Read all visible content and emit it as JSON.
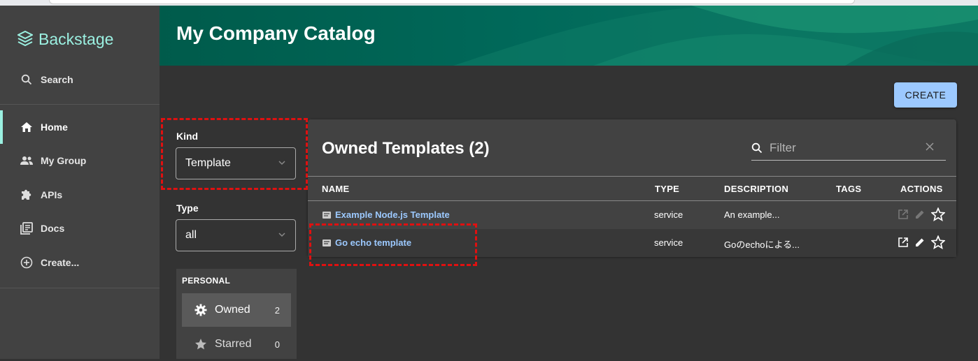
{
  "app": {
    "name": "Backstage",
    "page_title": "My Company Catalog"
  },
  "sidebar": {
    "search_label": "Search",
    "items": [
      {
        "label": "Home",
        "icon": "home-icon",
        "active": true
      },
      {
        "label": "My Group",
        "icon": "group-icon",
        "active": false
      },
      {
        "label": "APIs",
        "icon": "extension-icon",
        "active": false
      },
      {
        "label": "Docs",
        "icon": "library-books-icon",
        "active": false
      },
      {
        "label": "Create...",
        "icon": "add-circle-icon",
        "active": false
      }
    ]
  },
  "toolbar": {
    "create_label": "CREATE"
  },
  "filters": {
    "kind_label": "Kind",
    "kind_value": "Template",
    "type_label": "Type",
    "type_value": "all",
    "personal_title": "PERSONAL",
    "personal_items": [
      {
        "label": "Owned",
        "count": "2",
        "icon": "gear-icon",
        "selected": true
      },
      {
        "label": "Starred",
        "count": "0",
        "icon": "star-icon",
        "selected": false
      }
    ]
  },
  "table": {
    "title": "Owned Templates (2)",
    "filter_placeholder": "Filter",
    "columns": [
      "NAME",
      "TYPE",
      "DESCRIPTION",
      "TAGS",
      "ACTIONS"
    ],
    "rows": [
      {
        "name": "Example Node.js Template",
        "type": "service",
        "description": "An example...",
        "tags": "",
        "actions_enabled": false
      },
      {
        "name": "Go echo template",
        "type": "service",
        "description": "Goのechoによる...",
        "tags": "",
        "actions_enabled": true
      }
    ]
  },
  "colors": {
    "accent": "#9bf0e1",
    "link": "#9cc9ff",
    "primary_button": "#9cc9ff",
    "highlight": "#e01010",
    "header": "#005b4b"
  }
}
